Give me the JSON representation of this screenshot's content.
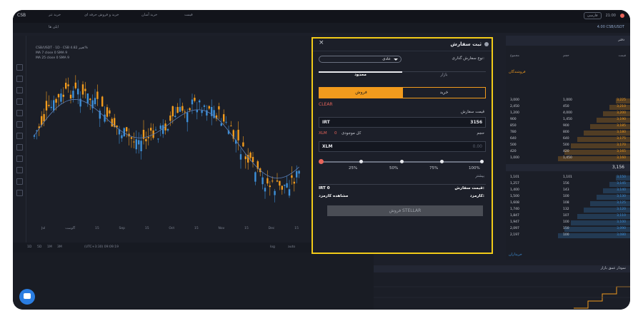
{
  "topbar": {
    "logo": "CSB",
    "menu": [
      "خرید تتر",
      "خرید و فروش حرفه ای",
      "خرید آسان",
      "قیمت"
    ],
    "lang": "فارسی",
    "time": "21:00"
  },
  "subbar": {
    "tab": "ایلن ها",
    "pair": "4.00 CSB/USDT"
  },
  "chart": {
    "info_lines": [
      "CSB/USDT · 1D · CSB  تغییر 4.82%",
      "MA 7 close 0 SMA 9",
      "MA 25 close 0 SMA 9"
    ],
    "x_labels": [
      "Jul",
      "آگوست",
      "15",
      "Sep",
      "15",
      "Oct",
      "15",
      "Nov",
      "15",
      "Dec",
      "15"
    ],
    "bottom_bar": [
      "1D",
      "5D",
      "1M",
      "3M",
      "(UTC+3:30) 09:09:19",
      "log",
      "auto"
    ]
  },
  "orderbook": {
    "title": "دفتر",
    "columns": [
      "مجموع",
      "حجم",
      "قیمت"
    ],
    "asks_label": "فروشندگان",
    "bids_label": "خریداران",
    "mid_price": "3,156",
    "asks": [
      [
        "3,000",
        "1,000",
        "3,225"
      ],
      [
        "2,450",
        "450",
        "3,210"
      ],
      [
        "1,200",
        "4,000",
        "3,200"
      ],
      [
        "900",
        "1,450",
        "3,190"
      ],
      [
        "850",
        "900",
        "3,185"
      ],
      [
        "780",
        "800",
        "3,180"
      ],
      [
        "640",
        "640",
        "3,175"
      ],
      [
        "500",
        "500",
        "3,170"
      ],
      [
        "420",
        "420",
        "3,165"
      ],
      [
        "1,000",
        "1,450",
        "3,160"
      ]
    ],
    "bids": [
      [
        "1,101",
        "1,101",
        "3,150"
      ],
      [
        "1,257",
        "156",
        "3,145"
      ],
      [
        "1,400",
        "143",
        "3,140"
      ],
      [
        "1,500",
        "100",
        "3,130"
      ],
      [
        "1,608",
        "108",
        "3,125"
      ],
      [
        "1,740",
        "132",
        "3,120"
      ],
      [
        "1,847",
        "107",
        "3,110"
      ],
      [
        "1,947",
        "100",
        "3,100"
      ],
      [
        "2,097",
        "150",
        "3,090"
      ],
      [
        "2,197",
        "100",
        "3,080"
      ]
    ]
  },
  "depth": {
    "title": "نمودار عمق بازار"
  },
  "modal": {
    "title": "ثبت سفارش",
    "close": "×",
    "order_type_label": "نوع سفارش گذاری:",
    "order_type_value": "عادی",
    "tabs": {
      "market": "بازار",
      "limit": "محدود"
    },
    "buy_label": "خرید",
    "sell_label": "فروش",
    "clear": "CLEAR",
    "price_label": "قیمت سفارش",
    "price_currency": "IRT",
    "price_value": "3156",
    "volume_label": "حجم",
    "balance_label": "کل موجودی",
    "balance_value": "0",
    "balance_currency": "XLM",
    "volume_currency": "XLM",
    "volume_placeholder": "0.00",
    "percent_labels": [
      "100%",
      "75%",
      "50%",
      "25%"
    ],
    "slider_value": 0,
    "fee_link": "بیشتر",
    "total_label": "قیمت سفارش:",
    "total_value": "IRT 0",
    "fee_label": "کارمزد:",
    "fee_value": "مشاهده کارمزد",
    "submit": "فروش STELLAR"
  },
  "colors": {
    "accent": "#f2cb18",
    "sell": "#f29b1d",
    "danger": "#e8645a",
    "up": "#f29b1d",
    "down": "#3d8fd8"
  }
}
